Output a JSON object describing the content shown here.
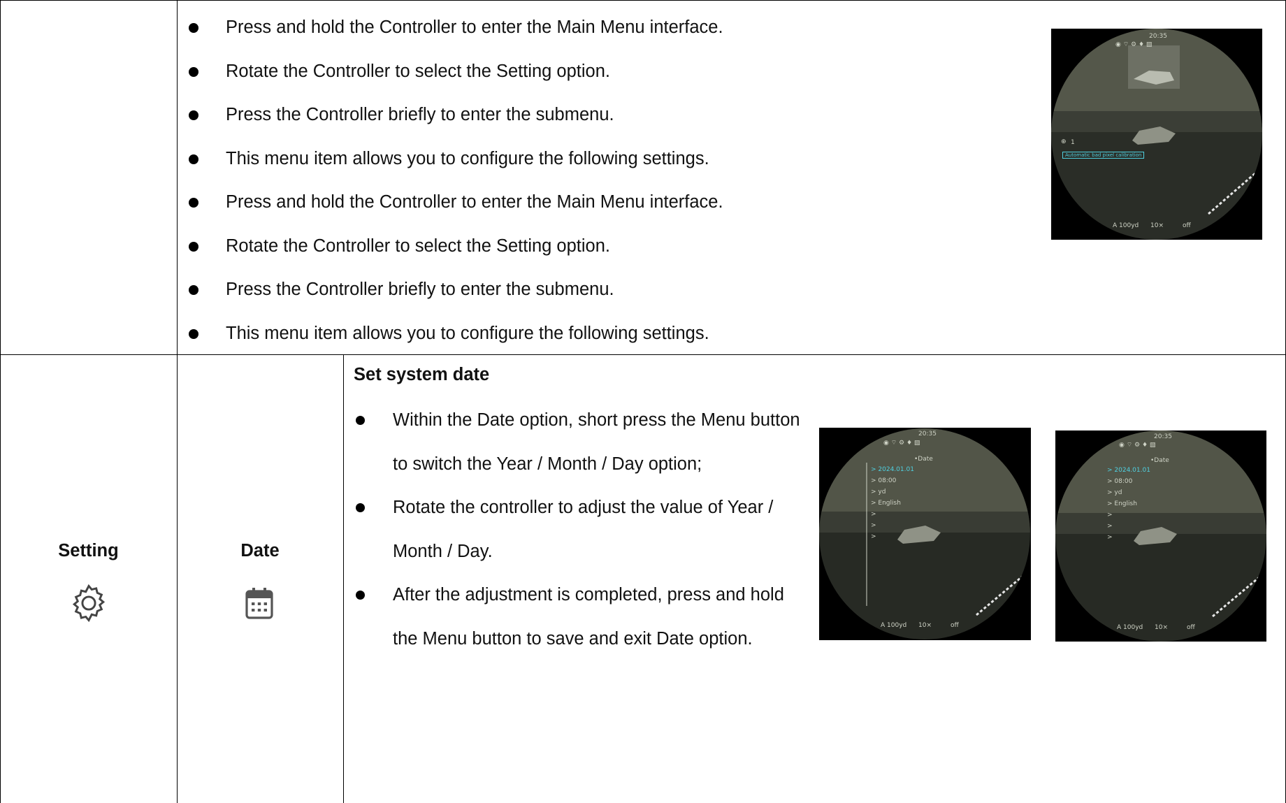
{
  "top_list": [
    "Press and hold the Controller to enter the Main Menu interface.",
    "Rotate the Controller to select the Setting option.",
    "Press the Controller briefly to enter the submenu.",
    "This menu item allows you to configure the following settings.",
    "Press and hold the Controller to enter the Main Menu interface.",
    "Rotate the Controller to select the Setting option.",
    "Press the Controller briefly to enter the submenu.",
    "This menu item allows you to configure the following settings."
  ],
  "setting_label": "Setting",
  "date_label": "Date",
  "date_section": {
    "heading": "Set system date",
    "bullets": [
      "Within the Date option, short press the Menu button to switch the Year / Month / Day option;",
      "Rotate the controller to adjust the value of Year / Month / Day.",
      "After the adjustment is completed, press and hold the Menu button to save and exit Date option."
    ]
  },
  "screen_main": {
    "time": "20:35",
    "calibration_text": "Automatic bad pixel calibration",
    "zero_index": "1",
    "footer_range": "A 100yd",
    "footer_zoom": "10×",
    "footer_status": "off"
  },
  "screen_date_a": {
    "time": "20:35",
    "menu_title": "•Date",
    "items": [
      "> 2024.01.01",
      "> 08:00",
      "> yd",
      "> English",
      ">",
      ">",
      ">"
    ],
    "footer_range": "A 100yd",
    "footer_zoom": "10×",
    "footer_status": "off"
  },
  "screen_date_b": {
    "time": "20:35",
    "menu_title": "•Date",
    "items": [
      "> 2024.01.01",
      "> 08:00",
      "> yd",
      "> English",
      ">",
      ">",
      ">"
    ],
    "footer_range": "A 100yd",
    "footer_zoom": "10×",
    "footer_status": "off"
  },
  "colors": {
    "highlight": "#4fd0e0",
    "osd_text": "#cfd3c6",
    "border": "#000000"
  },
  "icons": [
    "gear-icon",
    "calendar-icon",
    "boar-silhouette"
  ]
}
